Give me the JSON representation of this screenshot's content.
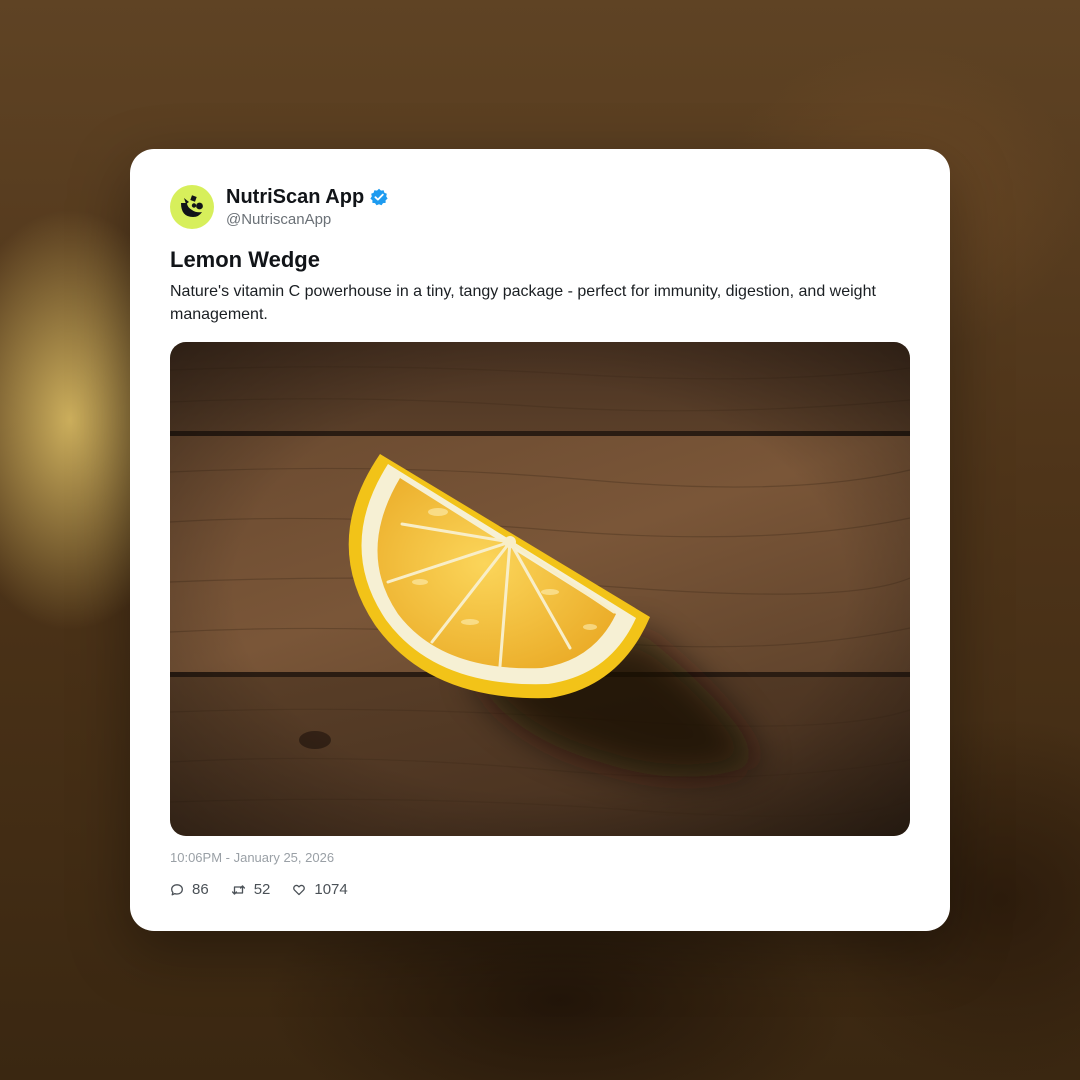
{
  "account": {
    "display_name": "NutriScan App",
    "handle": "@NutriscanApp",
    "verified": true,
    "avatar_icon": "nutriscan-logo-icon",
    "avatar_color": "#d7ef5b",
    "verified_color": "#1d9bf0"
  },
  "post": {
    "title": "Lemon Wedge",
    "body": "Nature's vitamin C powerhouse in a tiny, tangy package - perfect for immunity, digestion, and weight management.",
    "image_subject": "lemon-wedge-on-wooden-table-photo",
    "timestamp": "10:06PM - January 25, 2026"
  },
  "stats": {
    "replies": {
      "icon": "comment-icon",
      "count": "86"
    },
    "reposts": {
      "icon": "repost-icon",
      "count": "52"
    },
    "likes": {
      "icon": "heart-icon",
      "count": "1074"
    }
  }
}
